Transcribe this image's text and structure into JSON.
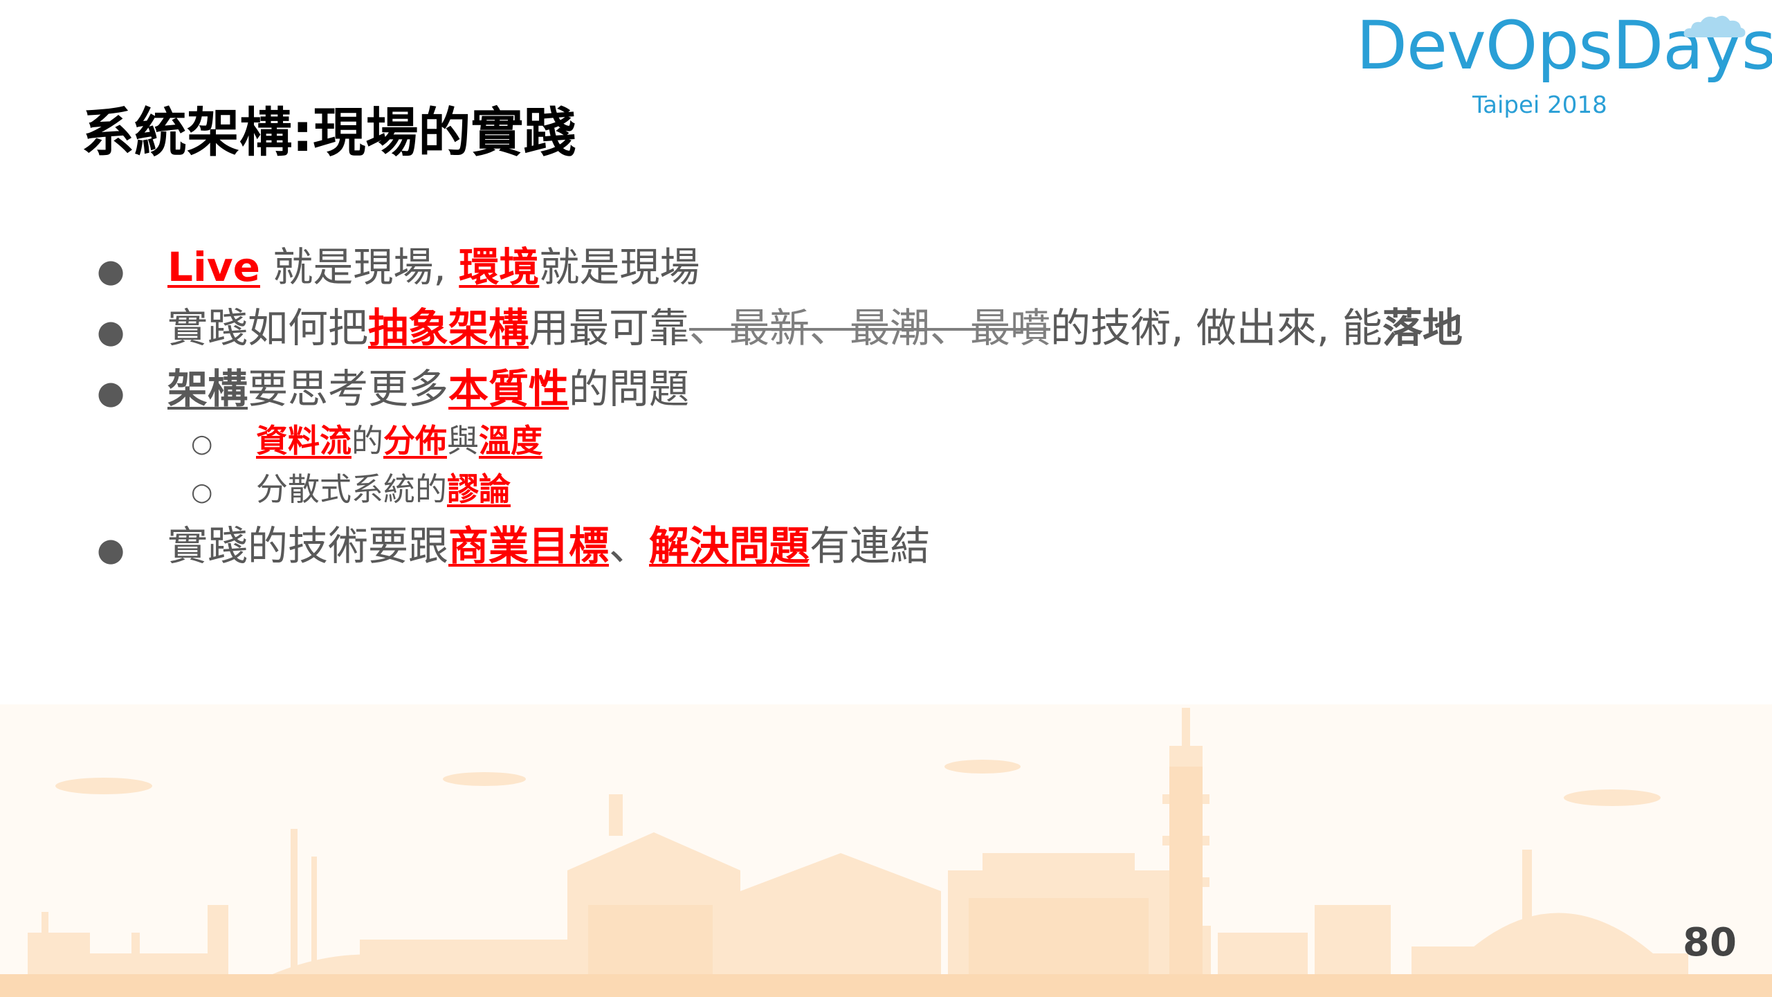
{
  "logo": {
    "word": "DevOpsDays",
    "sub": "Taipei 2018"
  },
  "title": "系統架構:現場的實踐",
  "bullets": [
    {
      "parts": [
        {
          "t": "Live",
          "s": "red"
        },
        {
          "t": " 就是現場, ",
          "s": "plain"
        },
        {
          "t": "環境",
          "s": "red"
        },
        {
          "t": "就是現場",
          "s": "plain"
        }
      ]
    },
    {
      "parts": [
        {
          "t": "實踐如何把",
          "s": "plain"
        },
        {
          "t": "抽象架構",
          "s": "red"
        },
        {
          "t": "用最可靠",
          "s": "plain"
        },
        {
          "t": "、最新、最潮、最噴",
          "s": "strike"
        },
        {
          "t": "的技術, 做出來, 能",
          "s": "plain"
        },
        {
          "t": "落地",
          "s": "bold"
        }
      ]
    },
    {
      "parts": [
        {
          "t": "架構",
          "s": "boldu"
        },
        {
          "t": "要思考更多",
          "s": "plain"
        },
        {
          "t": "本質性",
          "s": "red"
        },
        {
          "t": "的問題",
          "s": "plain"
        }
      ]
    },
    {
      "sub": true,
      "parts": [
        {
          "t": "資料流",
          "s": "red"
        },
        {
          "t": "的",
          "s": "plain"
        },
        {
          "t": "分佈",
          "s": "red"
        },
        {
          "t": "與",
          "s": "plain"
        },
        {
          "t": "溫度",
          "s": "red"
        }
      ]
    },
    {
      "sub": true,
      "parts": [
        {
          "t": "分散式系統的",
          "s": "plain"
        },
        {
          "t": "謬論",
          "s": "red"
        }
      ]
    },
    {
      "parts": [
        {
          "t": "實踐的技術要跟",
          "s": "plain"
        },
        {
          "t": "商業目標",
          "s": "red"
        },
        {
          "t": "、",
          "s": "plain"
        },
        {
          "t": "解決問題",
          "s": "red"
        },
        {
          "t": "有連結",
          "s": "plain"
        }
      ]
    }
  ],
  "markers": {
    "main": "●",
    "sub": "○"
  },
  "page_number": "80",
  "colors": {
    "accent": "#ff0000",
    "logo": "#2a9fd6",
    "skyline": "#fde8cf",
    "text": "#595959"
  }
}
